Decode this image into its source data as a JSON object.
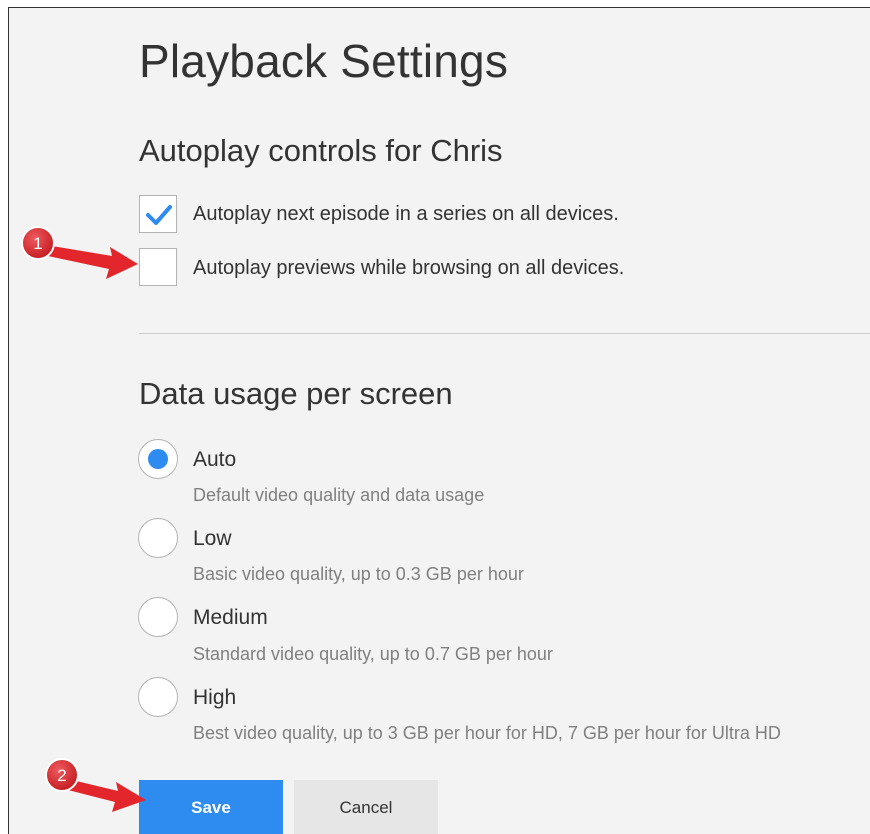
{
  "page": {
    "title": "Playback Settings"
  },
  "autoplay": {
    "heading": "Autoplay controls for Chris",
    "options": [
      {
        "label": "Autoplay next episode in a series on all devices.",
        "checked": true
      },
      {
        "label": "Autoplay previews while browsing on all devices.",
        "checked": false
      }
    ]
  },
  "data_usage": {
    "heading": "Data usage per screen",
    "selected": "Auto",
    "options": [
      {
        "label": "Auto",
        "description": "Default video quality and data usage"
      },
      {
        "label": "Low",
        "description": "Basic video quality, up to 0.3 GB per hour"
      },
      {
        "label": "Medium",
        "description": "Standard video quality, up to 0.7 GB per hour"
      },
      {
        "label": "High",
        "description": "Best video quality, up to 3 GB per hour for HD, 7 GB per hour for Ultra HD"
      }
    ]
  },
  "buttons": {
    "save": "Save",
    "cancel": "Cancel"
  },
  "annotations": {
    "marker_1": "1",
    "marker_2": "2"
  },
  "colors": {
    "accent": "#2e8bf0",
    "annotation": "#e3262b",
    "background": "#f3f3f3"
  },
  "icons": {
    "checkmark": "check-icon",
    "arrow": "red-arrow-icon"
  }
}
